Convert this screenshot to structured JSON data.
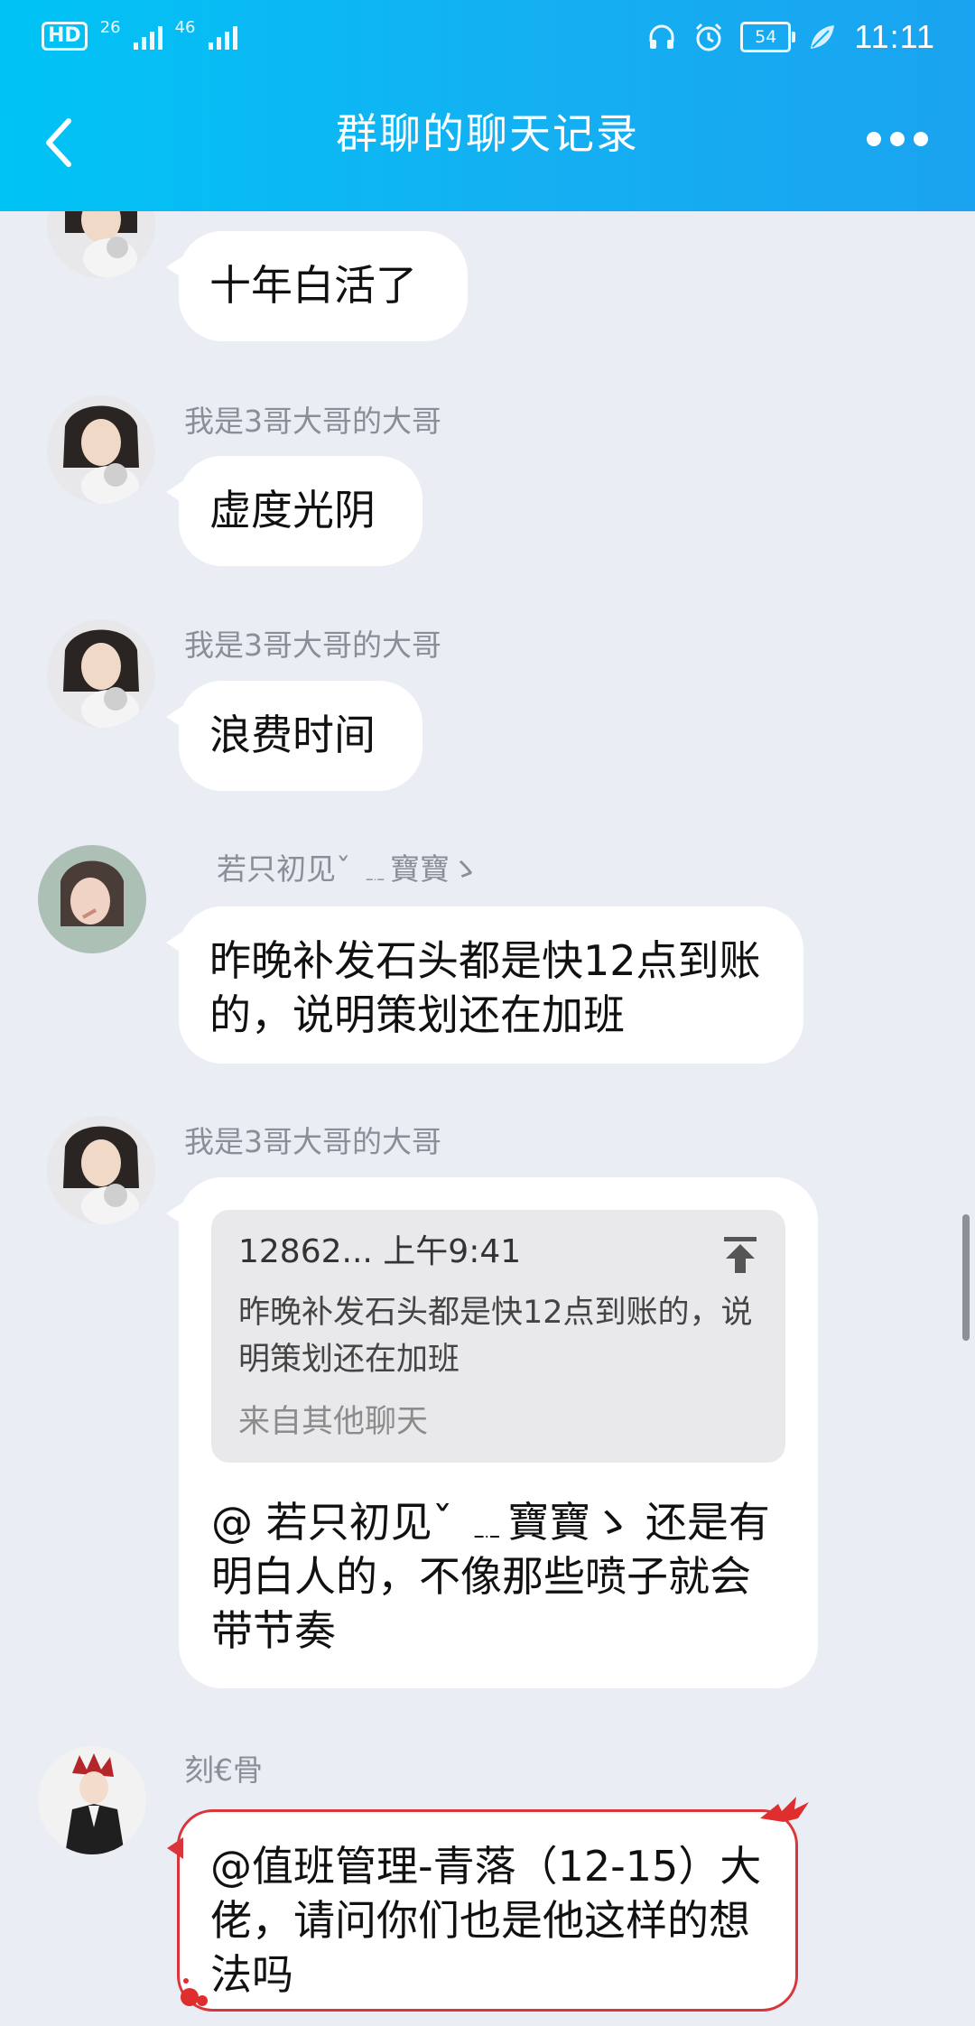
{
  "status_bar": {
    "hd": "HD",
    "sim2": "2",
    "network1": "26",
    "network2": "46",
    "battery": "54",
    "time": "11:11"
  },
  "header": {
    "title": "群聊的聊天记录",
    "back_icon": "chevron-left-icon",
    "more_icon": "more-dots-icon"
  },
  "messages": [
    {
      "sender": "",
      "text": "十年白活了"
    },
    {
      "sender": "我是3哥大哥的大哥",
      "text": "虚度光阴"
    },
    {
      "sender": "我是3哥大哥的大哥",
      "text": "浪费时间"
    },
    {
      "sender": "若只初见ˇ ﹎寶寶ゝ",
      "text": "昨晚补发石头都是快12点到账的，说明策划还在加班"
    },
    {
      "sender": "我是3哥大哥的大哥",
      "quote": {
        "head": "12862... 上午9:41",
        "body": "昨晚补发石头都是快12点到账的，说明策划还在加班",
        "source": "来自其他聊天"
      },
      "text": "@   若只初见ˇ ﹎寶寶ゝ 还是有明白人的，不像那些喷子就会带节奏"
    },
    {
      "sender": "刻€骨",
      "text": "@值班管理-青落（12-15）大佬，请问你们也是他这样的想法吗"
    }
  ],
  "colors": {
    "header_start": "#00c3f5",
    "header_end": "#1aa3f0",
    "background": "#eaedf4",
    "bubble": "#ffffff",
    "special_border": "#d9353a"
  }
}
